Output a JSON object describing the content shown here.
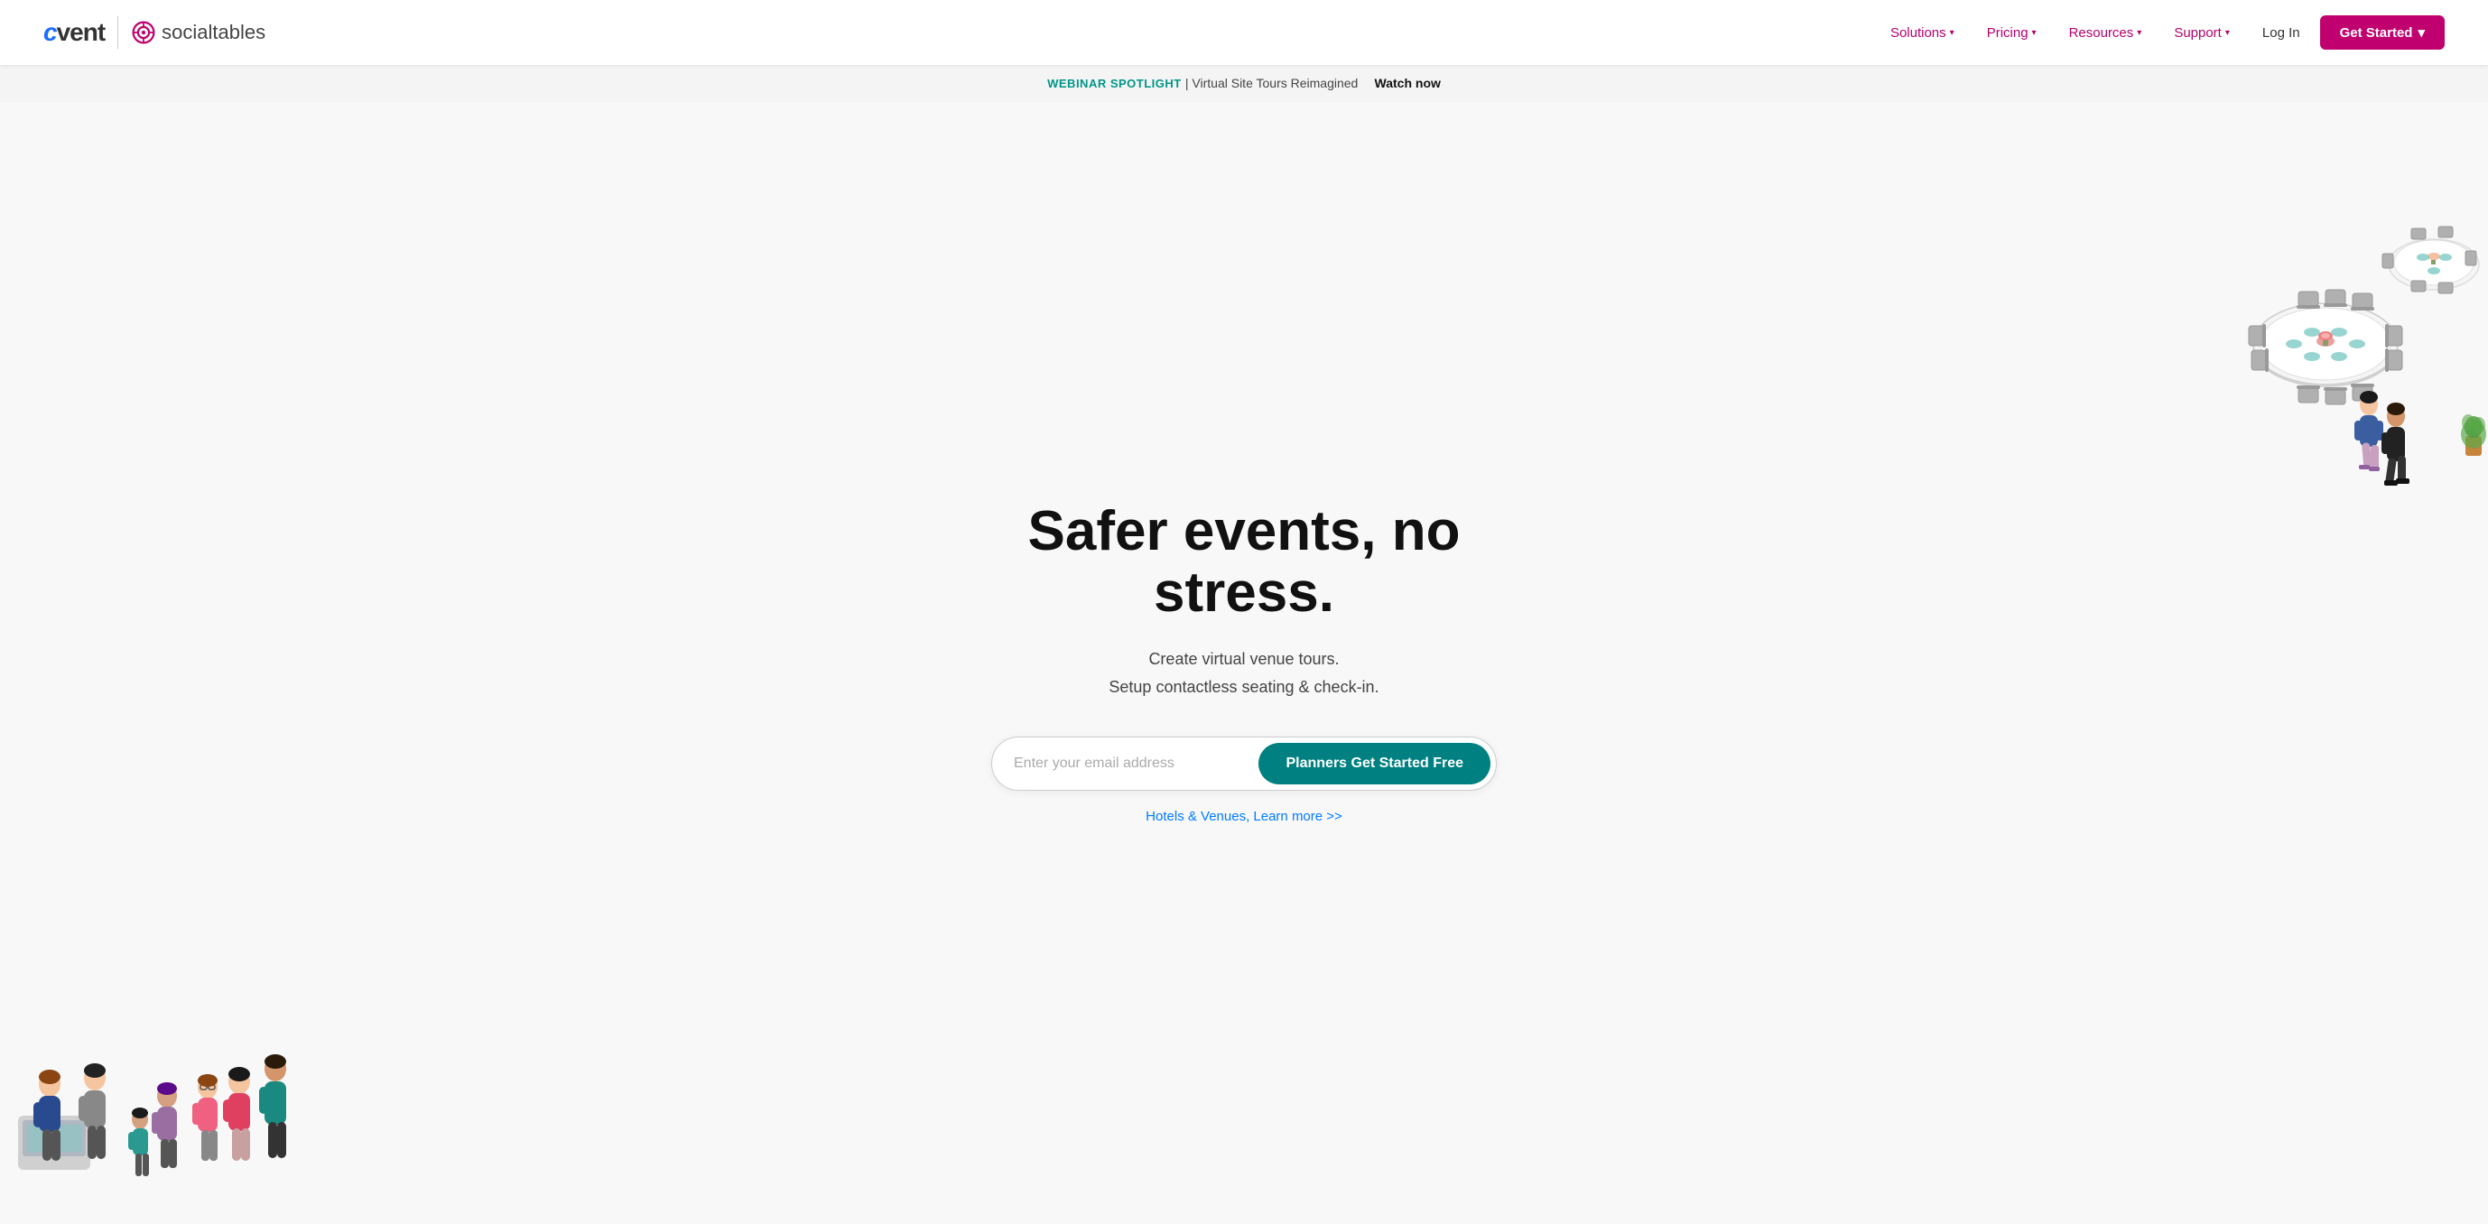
{
  "logo": {
    "cvent_text": "cvent",
    "socialtables_text": "socialtables"
  },
  "nav": {
    "solutions_label": "Solutions",
    "pricing_label": "Pricing",
    "resources_label": "Resources",
    "support_label": "Support",
    "login_label": "Log In",
    "get_started_label": "Get Started"
  },
  "announcement": {
    "label": "WEBINAR SPOTLIGHT",
    "title": "| Virtual Site Tours Reimagined",
    "watch_now": "Watch now"
  },
  "hero": {
    "headline": "Safer events, no stress.",
    "subline1": "Create virtual venue tours.",
    "subline2": "Setup contactless seating & check-in.",
    "email_placeholder": "Enter your email address",
    "cta_label": "Planners Get Started Free",
    "hotel_link": "Hotels & Venues, Learn more >>"
  }
}
